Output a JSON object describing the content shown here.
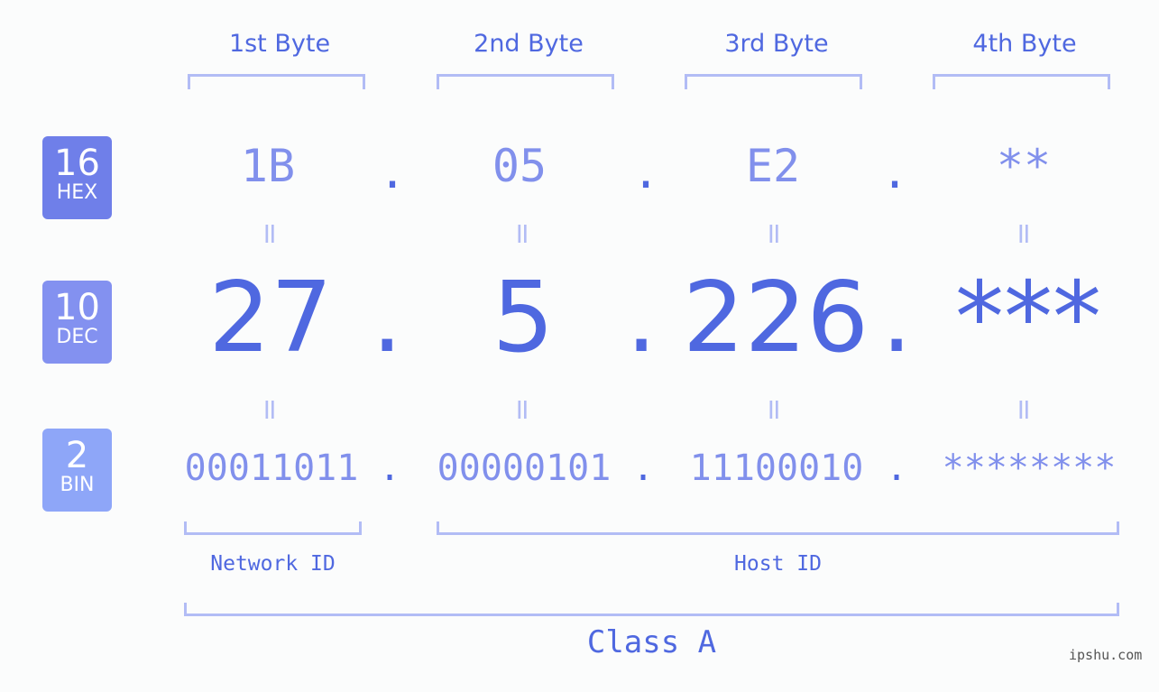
{
  "bytes_header": [
    "1st Byte",
    "2nd Byte",
    "3rd Byte",
    "4th Byte"
  ],
  "badges": {
    "hex": {
      "num": "16",
      "label": "HEX",
      "color": "#6f7fe9"
    },
    "dec": {
      "num": "10",
      "label": "DEC",
      "color": "#8391f0"
    },
    "bin": {
      "num": "2",
      "label": "BIN",
      "color": "#8ea6f8"
    }
  },
  "hex": [
    "1B",
    "05",
    "E2",
    "**"
  ],
  "dec": [
    "27",
    "5",
    "226",
    "***"
  ],
  "bin": [
    "00011011",
    "00000101",
    "11100010",
    "********"
  ],
  "separator": ".",
  "equals": "=",
  "labels": {
    "network": "Network ID",
    "host": "Host ID",
    "class": "Class A"
  },
  "watermark": "ipshu.com",
  "colors": {
    "primary": "#4f68e0",
    "light": "#8190ec",
    "bracket": "#b2bcf5"
  }
}
